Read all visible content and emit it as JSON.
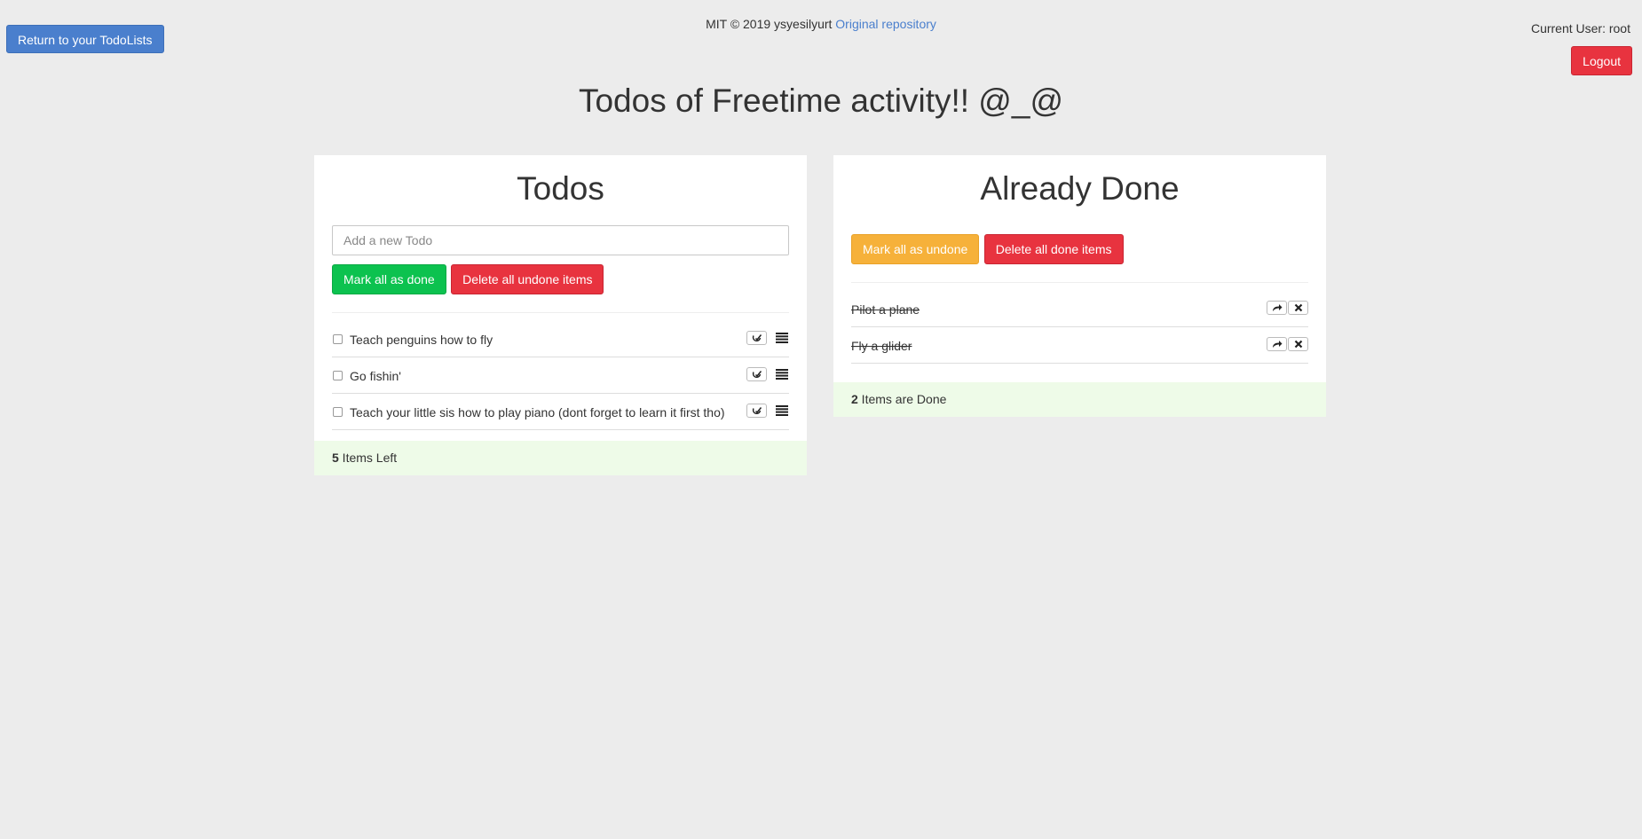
{
  "header": {
    "return_label": "Return to your TodoLists",
    "credit_text": "MIT © 2019 ysyesilyurt",
    "credit_link": "Original repository",
    "current_user": "Current User: root",
    "logout_label": "Logout"
  },
  "page_title": "Todos of Freetime activity!! @_@",
  "todos": {
    "title": "Todos",
    "input_placeholder": "Add a new Todo",
    "input_value": "",
    "mark_all_done_label": "Mark all as done",
    "delete_undone_label": "Delete all undone items",
    "items": [
      {
        "text": "Teach penguins how to fly"
      },
      {
        "text": "Go fishin'"
      },
      {
        "text": "Teach your little sis how to play piano (dont forget to learn it first tho)"
      }
    ],
    "footer_count": "5",
    "footer_text": " Items Left"
  },
  "done": {
    "title": "Already Done",
    "mark_all_undone_label": "Mark all as undone",
    "delete_done_label": "Delete all done items",
    "items": [
      {
        "text": "Pilot a plane"
      },
      {
        "text": "Fly a glider"
      }
    ],
    "footer_count": "2",
    "footer_text": " Items are Done"
  },
  "colors": {
    "background": "#ececec",
    "primary": "#4a7fcd",
    "danger": "#e8333f",
    "success": "#0cc24f",
    "warning": "#f6b13a",
    "footer_bg": "#eefbe8"
  },
  "icons": {
    "edit": "edit-icon",
    "reorder": "reorder-icon",
    "undo": "share-arrow-icon",
    "remove": "close-icon"
  }
}
